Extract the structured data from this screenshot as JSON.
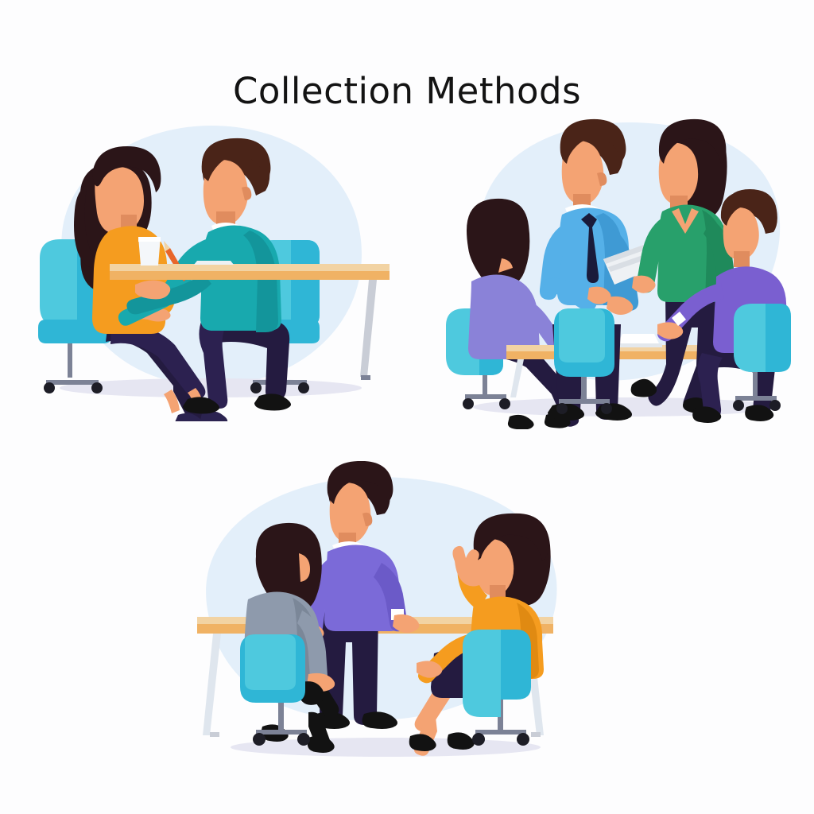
{
  "page": {
    "title": "Collection Methods",
    "background_color": "#fdfdfe",
    "title_color": "#131313"
  },
  "palette": {
    "blob_blue": "#e3effa",
    "chair_light": "#4ec9de",
    "chair_mid": "#2fb6d6",
    "chair_dark": "#1aa5c9",
    "table_top": "#f2d3a3",
    "table_body": "#f0b264",
    "leg_gray": "#c9cdd6",
    "base_gray": "#7c8296",
    "skin": "#f4a373",
    "skin_shade": "#e08c5e",
    "hair_dark": "#2b1518",
    "hair_brown": "#4a2418",
    "navy": "#241b40",
    "black": "#121212",
    "orange": "#f59c1f",
    "orange_shade": "#e08a12",
    "teal_sweater": "#18a9ae",
    "teal_sweater_shade": "#13959b",
    "shirt_blue": "#55b0e8",
    "shirt_blue_shade": "#3f9ad4",
    "tie_navy": "#1a1b3a",
    "green_top": "#28a06b",
    "green_top_shade": "#1f8a5b",
    "purple_light": "#8a82d8",
    "purple_mid": "#7b6ad8",
    "purple_deep": "#7a5fd0",
    "gray_top": "#8e9aac",
    "gray_top_shade": "#7b8798",
    "white": "#ffffff",
    "paper": "#e8ecef",
    "floor_shadow": "#e6e6f2"
  },
  "panels": [
    {
      "id": "panel-interview",
      "name": "interview-illustration",
      "caption": "",
      "scene": "one-on-one interview at desk",
      "figures": [
        {
          "role": "interviewee-woman",
          "top_color": "#f59c1f",
          "pants_color": "#241b40",
          "hair_color": "#2b1518",
          "seated": true,
          "chair_color": "#2fb6d6"
        },
        {
          "role": "interviewer-man",
          "top_color": "#18a9ae",
          "pants_color": "#241b40",
          "hair_color": "#4a2418",
          "seated": true,
          "chair_color": "#2fb6d6",
          "holds": "pencil"
        }
      ],
      "props": [
        "desk",
        "cup",
        "pencil",
        "paper"
      ]
    },
    {
      "id": "panel-focus-group",
      "name": "focus-group-illustration",
      "caption": "",
      "scene": "focus group meeting around table",
      "figures": [
        {
          "role": "participant-woman-left",
          "top_color": "#8a82d8",
          "pants_color": "#241b40",
          "hair_color": "#2b1518",
          "seated": true,
          "chair_color": "#2fb6d6"
        },
        {
          "role": "facilitator-man",
          "top_color": "#55b0e8",
          "tie_color": "#1a1b3a",
          "pants_color": "#241b40",
          "hair_color": "#4a2418",
          "seated": false,
          "holds": "clipboard"
        },
        {
          "role": "presenter-woman",
          "top_color": "#28a06b",
          "pants_color": "#241b40",
          "hair_color": "#2b1518",
          "seated": false
        },
        {
          "role": "participant-man-right",
          "top_color": "#7a5fd0",
          "pants_color": "#241b40",
          "hair_color": "#4a2418",
          "seated": true,
          "chair_color": "#2fb6d6"
        }
      ],
      "props": [
        "table",
        "clipboard",
        "laptop",
        "chairs"
      ]
    },
    {
      "id": "panel-observation",
      "name": "observation-illustration",
      "caption": "",
      "scene": "group discussion, standing moderator with two seated women",
      "figures": [
        {
          "role": "participant-woman-gray",
          "top_color": "#8e9aac",
          "pants_color": "#121212",
          "hair_color": "#2b1518",
          "seated": true,
          "chair_color": "#2fb6d6"
        },
        {
          "role": "moderator-man",
          "top_color": "#7b6ad8",
          "pants_color": "#241b40",
          "hair_color": "#2b1518",
          "seated": false
        },
        {
          "role": "participant-woman-orange",
          "top_color": "#f59c1f",
          "skirt_color": "#241b40",
          "hair_color": "#2b1518",
          "seated": true,
          "chair_color": "#2fb6d6",
          "gesture": "raised-hand"
        }
      ],
      "props": [
        "table",
        "chairs"
      ]
    }
  ]
}
